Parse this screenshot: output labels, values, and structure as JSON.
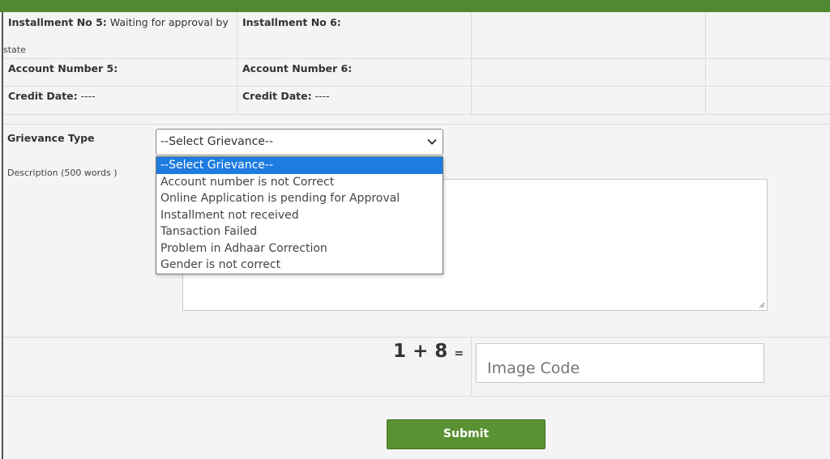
{
  "installments": {
    "inst5_label": "Installment No 5:",
    "inst5_status_line1": "Waiting for approval by",
    "inst5_status_line2": "state",
    "inst6_label": "Installment No 6:",
    "acc5_label": "Account Number 5:",
    "acc6_label": "Account Number 6:",
    "credit5_label": "Credit Date:",
    "credit5_value": "----",
    "credit6_label": "Credit Date:",
    "credit6_value": "----"
  },
  "grievance": {
    "label": "Grievance Type",
    "selected": "--Select Grievance--",
    "options": [
      "--Select Grievance--",
      "Account number is not Correct",
      "Online Application is pending for Approval",
      "Installment not received",
      "Tansaction Failed",
      "Problem in Adhaar Correction",
      "Gender is not correct"
    ]
  },
  "description": {
    "label": "Description (500 words )"
  },
  "captcha": {
    "expression": "1 + 8",
    "equals": "=",
    "placeholder": "Image Code"
  },
  "submit_label": "Submit",
  "colors": {
    "header": "#4f8a30",
    "submit": "#5a9233",
    "highlight": "#1e7ce0"
  }
}
